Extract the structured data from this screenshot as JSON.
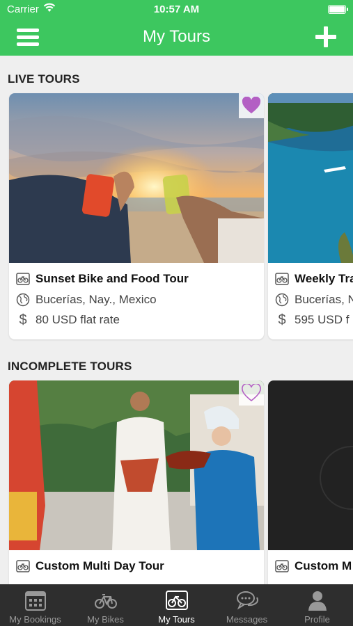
{
  "status_bar": {
    "carrier": "Carrier",
    "time": "10:57 AM"
  },
  "navbar": {
    "title": "My Tours",
    "menu_icon": "hamburger-icon",
    "add_icon": "plus-icon"
  },
  "sections": {
    "live": {
      "title": "LIVE TOURS",
      "cards": [
        {
          "name": "Sunset Bike and Food Tour",
          "location": "Bucerías, Nay., Mexico",
          "price": "80 USD flat rate",
          "favorited": true
        },
        {
          "name": "Weekly Tra",
          "location": "Bucerías, N",
          "price": "595 USD f"
        }
      ]
    },
    "incomplete": {
      "title": "INCOMPLETE TOURS",
      "cards": [
        {
          "name": "Custom Multi Day Tour",
          "favorited": false
        },
        {
          "name": "Custom M"
        }
      ]
    }
  },
  "colors": {
    "brand_green": "#3dc75f",
    "favorite_purple": "#b35fc4",
    "tabbar_bg": "#2e2e2e"
  },
  "tabbar": {
    "active": "My Tours",
    "tabs": [
      {
        "label": "My Bookings",
        "icon": "calendar-icon"
      },
      {
        "label": "My Bikes",
        "icon": "bike-icon"
      },
      {
        "label": "My Tours",
        "icon": "tour-bike-icon"
      },
      {
        "label": "Messages",
        "icon": "messages-icon"
      },
      {
        "label": "Profile",
        "icon": "profile-icon"
      }
    ]
  }
}
